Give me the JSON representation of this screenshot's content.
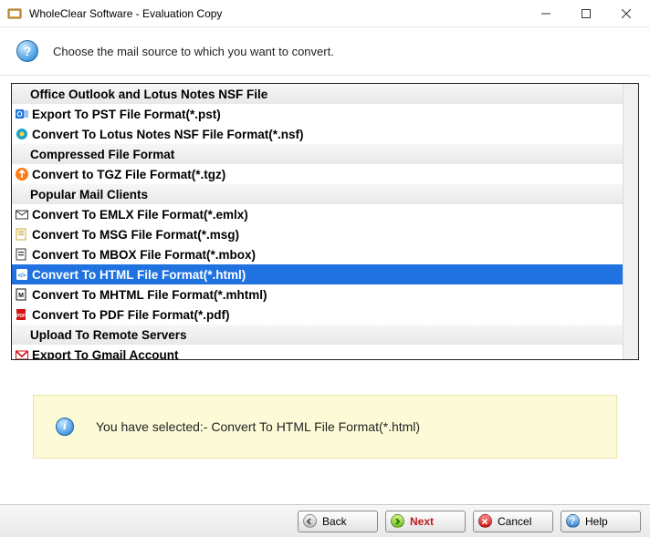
{
  "window": {
    "title": "WholeClear Software - Evaluation Copy"
  },
  "instruction": "Choose the mail source to which you want to convert.",
  "list": [
    {
      "kind": "header",
      "label": "Office Outlook and Lotus Notes NSF File"
    },
    {
      "kind": "item",
      "icon": "outlook-icon",
      "label": "Export To PST File Format(*.pst)"
    },
    {
      "kind": "item",
      "icon": "lotus-notes-icon",
      "label": "Convert To Lotus Notes NSF File Format(*.nsf)"
    },
    {
      "kind": "header",
      "label": "Compressed File Format"
    },
    {
      "kind": "item",
      "icon": "tgz-icon",
      "label": "Convert to TGZ File Format(*.tgz)"
    },
    {
      "kind": "header",
      "label": "Popular Mail Clients"
    },
    {
      "kind": "item",
      "icon": "emlx-icon",
      "label": "Convert To EMLX File Format(*.emlx)"
    },
    {
      "kind": "item",
      "icon": "msg-icon",
      "label": "Convert To MSG File Format(*.msg)"
    },
    {
      "kind": "item",
      "icon": "mbox-icon",
      "label": "Convert To MBOX File Format(*.mbox)"
    },
    {
      "kind": "item",
      "icon": "html-icon",
      "label": "Convert To HTML File Format(*.html)",
      "selected": true
    },
    {
      "kind": "item",
      "icon": "mhtml-icon",
      "label": "Convert To MHTML File Format(*.mhtml)"
    },
    {
      "kind": "item",
      "icon": "pdf-icon",
      "label": "Convert To PDF File Format(*.pdf)"
    },
    {
      "kind": "header",
      "label": "Upload To Remote Servers"
    },
    {
      "kind": "item",
      "icon": "gmail-icon",
      "label": "Export To Gmail Account"
    }
  ],
  "status": {
    "prefix": "You have selected:- ",
    "value": "Convert To HTML File Format(*.html)"
  },
  "buttons": {
    "back": "Back",
    "next": "Next",
    "cancel": "Cancel",
    "help": "Help"
  }
}
